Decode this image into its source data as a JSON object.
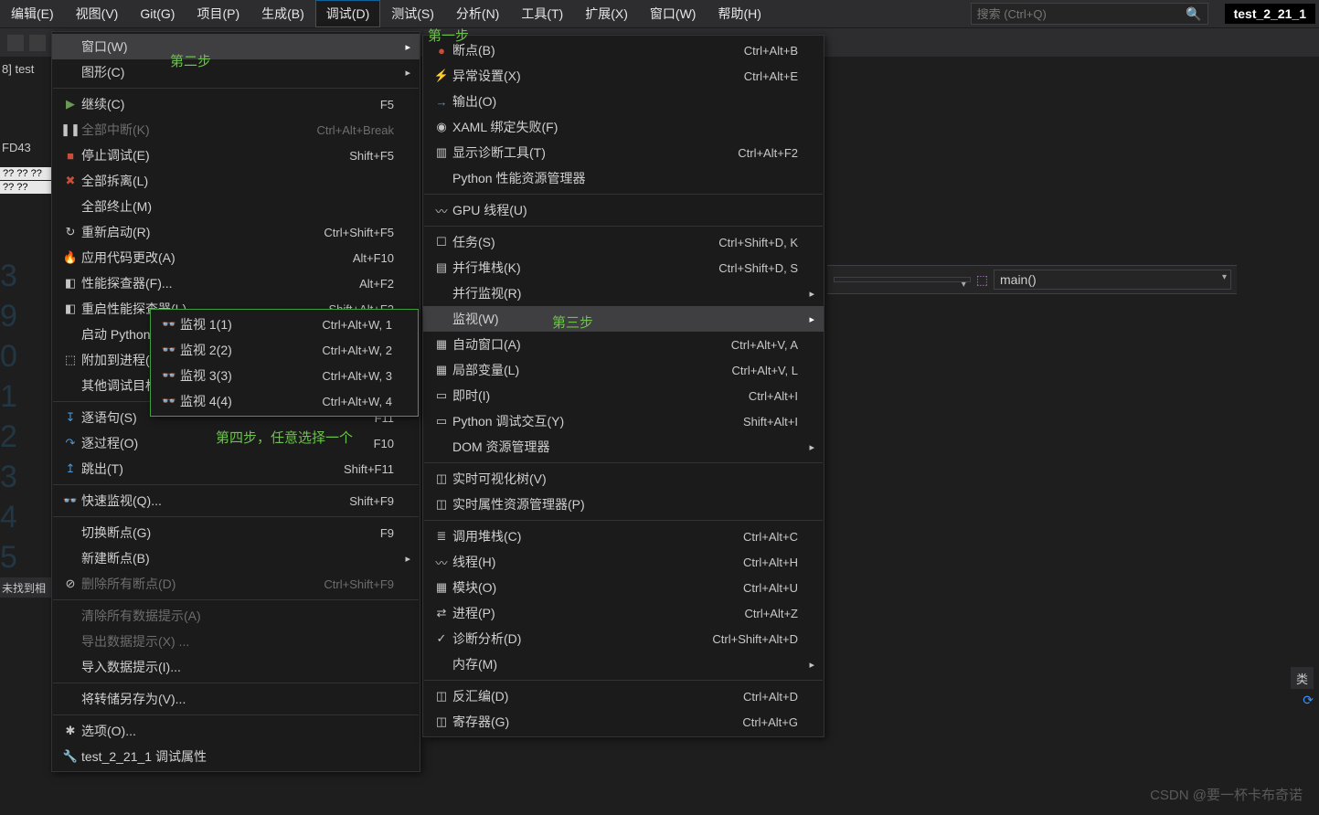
{
  "menubar": {
    "items": [
      "编辑(E)",
      "视图(V)",
      "Git(G)",
      "项目(P)",
      "生成(B)",
      "调试(D)",
      "测试(S)",
      "分析(N)",
      "工具(T)",
      "扩展(X)",
      "窗口(W)",
      "帮助(H)"
    ],
    "active_index": 5
  },
  "search": {
    "placeholder": "搜索 (Ctrl+Q)"
  },
  "project_name": "test_2_21_1",
  "left_fragments": {
    "r1": "8] test",
    "r2": "FD43",
    "box1": "?? ?? ??",
    "box2": "?? ??",
    "bottom": "未找到相"
  },
  "gutter_digits": [
    "3",
    "9",
    "0",
    "1",
    "2",
    "3",
    "4",
    "5"
  ],
  "crumb": {
    "select_empty": "",
    "main": "main()"
  },
  "annotations": {
    "step1": "第一步",
    "step2": "第二步",
    "step3": "第三步",
    "step4": "第四步，任意选择一个"
  },
  "debug_menu": [
    {
      "label": "窗口(W)",
      "sc": "",
      "icon": "",
      "arrow": true,
      "hl": true
    },
    {
      "label": "图形(C)",
      "sc": "",
      "icon": "",
      "arrow": true
    },
    {
      "sep": true
    },
    {
      "label": "继续(C)",
      "sc": "F5",
      "icon": "▶",
      "icls": "green"
    },
    {
      "label": "全部中断(K)",
      "sc": "Ctrl+Alt+Break",
      "icon": "❚❚",
      "disabled": true
    },
    {
      "label": "停止调试(E)",
      "sc": "Shift+F5",
      "icon": "■",
      "icls": "red"
    },
    {
      "label": "全部拆离(L)",
      "sc": "",
      "icon": "✖",
      "icls": "red"
    },
    {
      "label": "全部终止(M)",
      "sc": "",
      "icon": ""
    },
    {
      "label": "重新启动(R)",
      "sc": "Ctrl+Shift+F5",
      "icon": "↻"
    },
    {
      "label": "应用代码更改(A)",
      "sc": "Alt+F10",
      "icon": "🔥",
      "icls": "orange"
    },
    {
      "label": "性能探查器(F)...",
      "sc": "Alt+F2",
      "icon": "◧"
    },
    {
      "label": "重启性能探查器(L)",
      "sc": "Shift+Alt+F2",
      "icon": "◧"
    },
    {
      "label": "启动 Python 分析(A)",
      "sc": "",
      "icon": ""
    },
    {
      "label": "附加到进程(P)...",
      "sc": "",
      "icon": "⬚"
    },
    {
      "label": "其他调试目标(H)",
      "sc": "",
      "icon": "",
      "arrow": true
    },
    {
      "sep": true
    },
    {
      "label": "逐语句(S)",
      "sc": "F11",
      "icon": "↧",
      "icls": "blue"
    },
    {
      "label": "逐过程(O)",
      "sc": "F10",
      "icon": "↷",
      "icls": "blue"
    },
    {
      "label": "跳出(T)",
      "sc": "Shift+F11",
      "icon": "↥",
      "icls": "blue"
    },
    {
      "sep": true
    },
    {
      "label": "快速监视(Q)...",
      "sc": "Shift+F9",
      "icon": "👓"
    },
    {
      "sep": true
    },
    {
      "label": "切换断点(G)",
      "sc": "F9",
      "icon": ""
    },
    {
      "label": "新建断点(B)",
      "sc": "",
      "icon": "",
      "arrow": true
    },
    {
      "label": "删除所有断点(D)",
      "sc": "Ctrl+Shift+F9",
      "icon": "⊘",
      "disabled": true
    },
    {
      "sep": true
    },
    {
      "label": "清除所有数据提示(A)",
      "sc": "",
      "icon": "",
      "disabled": true
    },
    {
      "label": "导出数据提示(X) ...",
      "sc": "",
      "icon": "",
      "disabled": true
    },
    {
      "label": "导入数据提示(I)...",
      "sc": "",
      "icon": ""
    },
    {
      "sep": true
    },
    {
      "label": "将转储另存为(V)...",
      "sc": "",
      "icon": ""
    },
    {
      "sep": true
    },
    {
      "label": "选项(O)...",
      "sc": "",
      "icon": "✱"
    },
    {
      "label": "test_2_21_1 调试属性",
      "sc": "",
      "icon": "🔧"
    }
  ],
  "window_submenu": [
    {
      "label": "断点(B)",
      "sc": "Ctrl+Alt+B",
      "icon": "●",
      "icls": "red"
    },
    {
      "label": "异常设置(X)",
      "sc": "Ctrl+Alt+E",
      "icon": "⚡"
    },
    {
      "label": "输出(O)",
      "sc": "",
      "icon": "→",
      "icls": "blue"
    },
    {
      "label": "XAML 绑定失败(F)",
      "sc": "",
      "icon": "◉"
    },
    {
      "label": "显示诊断工具(T)",
      "sc": "Ctrl+Alt+F2",
      "icon": "▥"
    },
    {
      "label": "Python 性能资源管理器",
      "sc": "",
      "icon": ""
    },
    {
      "sep": true
    },
    {
      "label": "GPU 线程(U)",
      "sc": "",
      "icon": "〰"
    },
    {
      "sep": true
    },
    {
      "label": "任务(S)",
      "sc": "Ctrl+Shift+D, K",
      "icon": "☐"
    },
    {
      "label": "并行堆栈(K)",
      "sc": "Ctrl+Shift+D, S",
      "icon": "▤"
    },
    {
      "label": "并行监视(R)",
      "sc": "",
      "icon": "",
      "arrow": true
    },
    {
      "label": "监视(W)",
      "sc": "",
      "icon": "",
      "arrow": true,
      "hl": true
    },
    {
      "label": "自动窗口(A)",
      "sc": "Ctrl+Alt+V, A",
      "icon": "▦"
    },
    {
      "label": "局部变量(L)",
      "sc": "Ctrl+Alt+V, L",
      "icon": "▦"
    },
    {
      "label": "即时(I)",
      "sc": "Ctrl+Alt+I",
      "icon": "▭"
    },
    {
      "label": "Python 调试交互(Y)",
      "sc": "Shift+Alt+I",
      "icon": "▭"
    },
    {
      "label": "DOM 资源管理器",
      "sc": "",
      "icon": "",
      "arrow": true
    },
    {
      "sep": true
    },
    {
      "label": "实时可视化树(V)",
      "sc": "",
      "icon": "◫"
    },
    {
      "label": "实时属性资源管理器(P)",
      "sc": "",
      "icon": "◫"
    },
    {
      "sep": true
    },
    {
      "label": "调用堆栈(C)",
      "sc": "Ctrl+Alt+C",
      "icon": "≣"
    },
    {
      "label": "线程(H)",
      "sc": "Ctrl+Alt+H",
      "icon": "〰"
    },
    {
      "label": "模块(O)",
      "sc": "Ctrl+Alt+U",
      "icon": "▦"
    },
    {
      "label": "进程(P)",
      "sc": "Ctrl+Alt+Z",
      "icon": "⇄"
    },
    {
      "label": "诊断分析(D)",
      "sc": "Ctrl+Shift+Alt+D",
      "icon": "✓"
    },
    {
      "label": "内存(M)",
      "sc": "",
      "icon": "",
      "arrow": true
    },
    {
      "sep": true
    },
    {
      "label": "反汇编(D)",
      "sc": "Ctrl+Alt+D",
      "icon": "◫"
    },
    {
      "label": "寄存器(G)",
      "sc": "Ctrl+Alt+G",
      "icon": "◫"
    }
  ],
  "watch_submenu": [
    {
      "label": "监视 1(1)",
      "sc": "Ctrl+Alt+W, 1",
      "icon": "👓"
    },
    {
      "label": "监视 2(2)",
      "sc": "Ctrl+Alt+W, 2",
      "icon": "👓"
    },
    {
      "label": "监视 3(3)",
      "sc": "Ctrl+Alt+W, 3",
      "icon": "👓"
    },
    {
      "label": "监视 4(4)",
      "sc": "Ctrl+Alt+W, 4",
      "icon": "👓"
    }
  ],
  "right_label": "类",
  "watermark": "CSDN @要一杯卡布奇诺"
}
